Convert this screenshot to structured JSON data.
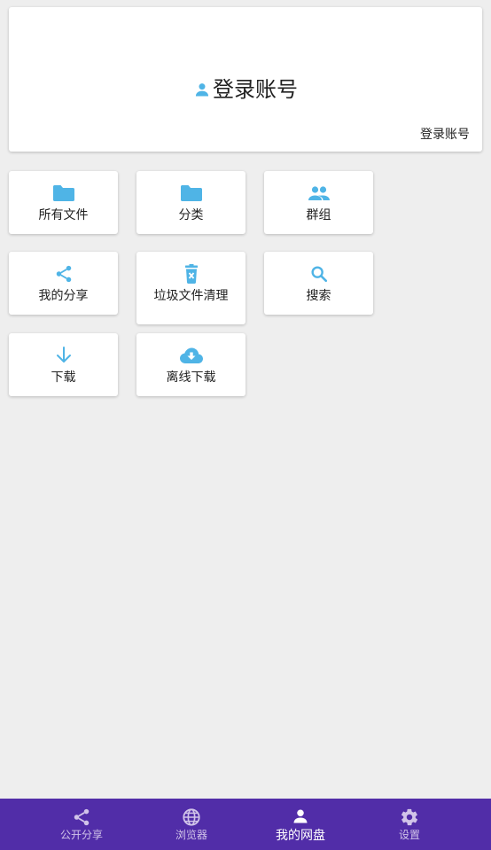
{
  "colors": {
    "accent": "#4fb4e6",
    "background": "#eeeeee",
    "nav_bar": "#512da8"
  },
  "login_card": {
    "title": "登录账号",
    "title_icon": "person-icon",
    "link": "登录账号"
  },
  "tiles": [
    {
      "label": "所有文件",
      "icon": "folder-icon"
    },
    {
      "label": "分类",
      "icon": "folder-icon"
    },
    {
      "label": "群组",
      "icon": "group-icon"
    },
    {
      "label": "我的分享",
      "icon": "share-icon"
    },
    {
      "label": "垃圾文件清理",
      "icon": "trash-icon"
    },
    {
      "label": "搜索",
      "icon": "search-icon"
    },
    {
      "label": "下载",
      "icon": "download-arrow-icon"
    },
    {
      "label": "离线下载",
      "icon": "cloud-download-icon"
    }
  ],
  "bottom_nav": {
    "items": [
      {
        "label": "公开分享",
        "icon": "share-icon"
      },
      {
        "label": "浏览器",
        "icon": "globe-icon"
      },
      {
        "label": "我的网盘",
        "icon": "person-icon"
      },
      {
        "label": "设置",
        "icon": "gear-icon"
      }
    ],
    "active": "我的网盘"
  }
}
